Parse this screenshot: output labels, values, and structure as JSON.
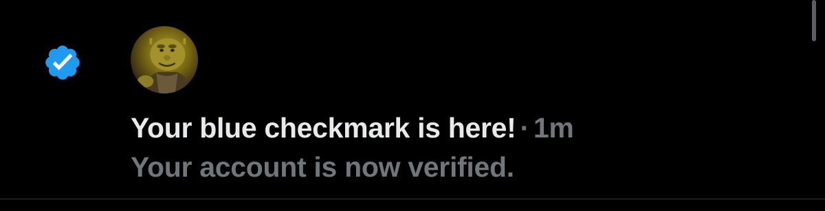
{
  "notification": {
    "badge_icon": "verified-badge-icon",
    "badge_color": "#1d9bf0",
    "avatar_icon": "user-avatar",
    "title": "Your blue checkmark is here!",
    "separator": "·",
    "timestamp": "1m",
    "body": "Your account is now verified."
  },
  "colors": {
    "background": "#000000",
    "primary_text": "#e7e9ea",
    "secondary_text": "#71767b",
    "divider": "#2f3336"
  }
}
